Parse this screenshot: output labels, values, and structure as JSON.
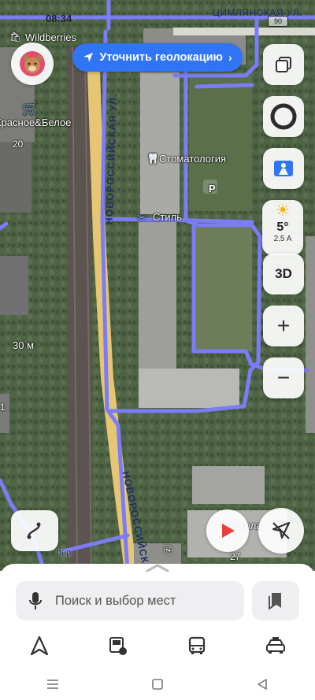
{
  "status": {
    "time": "08:34",
    "battery": "90",
    "street_top": "ЦИМЛЯНСКАЯ УЛ."
  },
  "geo_button": {
    "label": "Уточнить геолокацию",
    "arrow": "›"
  },
  "map_labels": {
    "wildberries": "Wildberries",
    "red_white": "Красное&Белое",
    "house_20": "20",
    "dentistry": "Стоматология",
    "style": "Стиль",
    "street_main": "НОВОРОССИЙСКАЯ УЛ.",
    "street_bottom": "НОВОРОССИЙСК",
    "street_small": "пер.",
    "distance": "30 м",
    "school": "Школа",
    "house_27": "27",
    "parking": "P",
    "edge_1": "1"
  },
  "weather": {
    "temp": "5°",
    "wind": "2.5 A"
  },
  "buttons": {
    "three_d": "3D",
    "zoom_in": "+",
    "zoom_out": "−"
  },
  "search": {
    "placeholder": "Поиск и выбор мест"
  },
  "colors": {
    "accent": "#2f75f5",
    "route": "#7b7cf7",
    "road": "#e8c873"
  }
}
